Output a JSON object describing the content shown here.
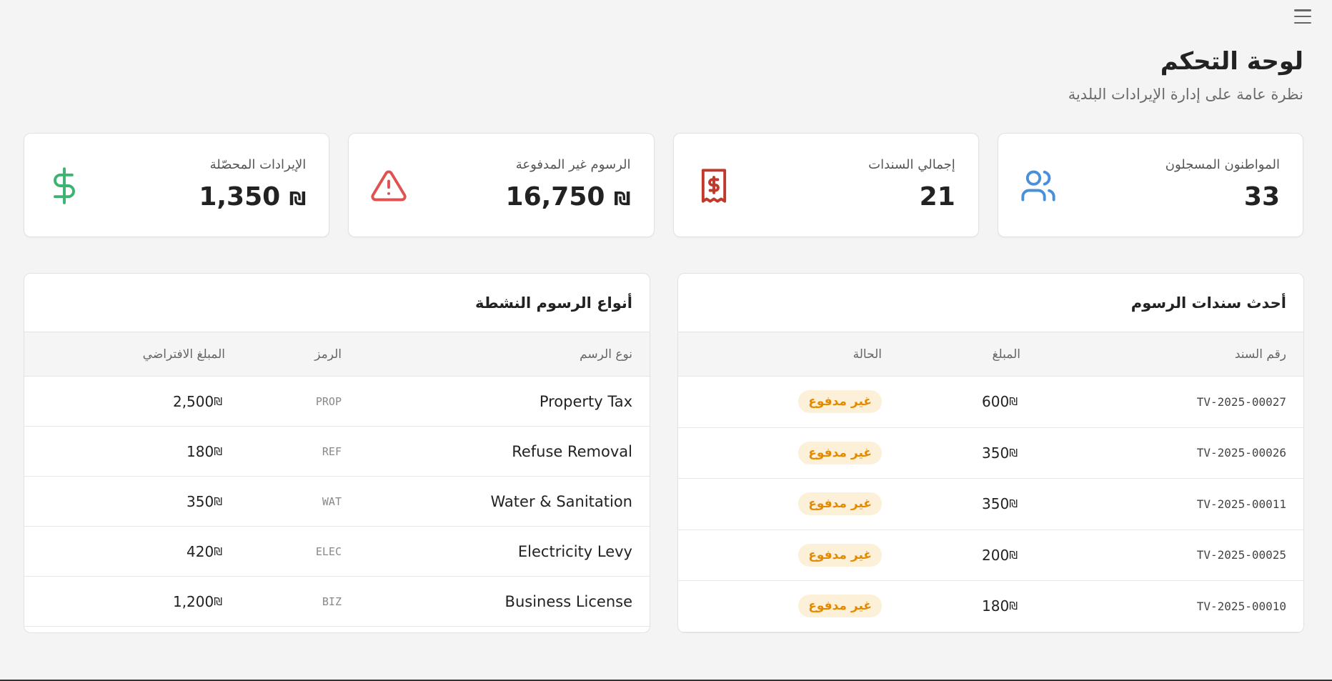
{
  "header": {
    "title": "لوحة التحكم",
    "subtitle": "نظرة عامة على إدارة الإيرادات البلدية"
  },
  "stats": [
    {
      "label": "المواطنون المسجلون",
      "value": "33",
      "icon": "users-icon",
      "color": "#4a90d9"
    },
    {
      "label": "إجمالي السندات",
      "value": "21",
      "icon": "receipt-icon",
      "color": "#c0392b"
    },
    {
      "label": "الرسوم غير المدفوعة",
      "value": "16,750",
      "currency": "₪",
      "icon": "warning-icon",
      "color": "#e05252"
    },
    {
      "label": "الإيرادات المحصّلة",
      "value": "1,350",
      "currency": "₪",
      "icon": "dollar-icon",
      "color": "#3cb371"
    }
  ],
  "recent_vouchers": {
    "title": "أحدث سندات الرسوم",
    "columns": [
      "رقم السند",
      "المبلغ",
      "الحالة"
    ],
    "rows": [
      {
        "number": "TV-2025-00027",
        "amount": "600",
        "currency": "₪",
        "status": "غير مدفوع"
      },
      {
        "number": "TV-2025-00026",
        "amount": "350",
        "currency": "₪",
        "status": "غير مدفوع"
      },
      {
        "number": "TV-2025-00011",
        "amount": "350",
        "currency": "₪",
        "status": "غير مدفوع"
      },
      {
        "number": "TV-2025-00025",
        "amount": "200",
        "currency": "₪",
        "status": "غير مدفوع"
      },
      {
        "number": "TV-2025-00010",
        "amount": "180",
        "currency": "₪",
        "status": "غير مدفوع"
      }
    ]
  },
  "fee_types": {
    "title": "أنواع الرسوم النشطة",
    "columns": [
      "نوع الرسم",
      "الرمز",
      "المبلغ الافتراضي"
    ],
    "rows": [
      {
        "name": "Property Tax",
        "code": "PROP",
        "amount": "2,500",
        "currency": "₪"
      },
      {
        "name": "Refuse Removal",
        "code": "REF",
        "amount": "180",
        "currency": "₪"
      },
      {
        "name": "Water & Sanitation",
        "code": "WAT",
        "amount": "350",
        "currency": "₪"
      },
      {
        "name": "Electricity Levy",
        "code": "ELEC",
        "amount": "420",
        "currency": "₪"
      },
      {
        "name": "Business License",
        "code": "BIZ",
        "amount": "1,200",
        "currency": "₪"
      }
    ]
  },
  "colors": {
    "badge_bg": "#fdf0d8",
    "badge_text": "#e58a00"
  }
}
